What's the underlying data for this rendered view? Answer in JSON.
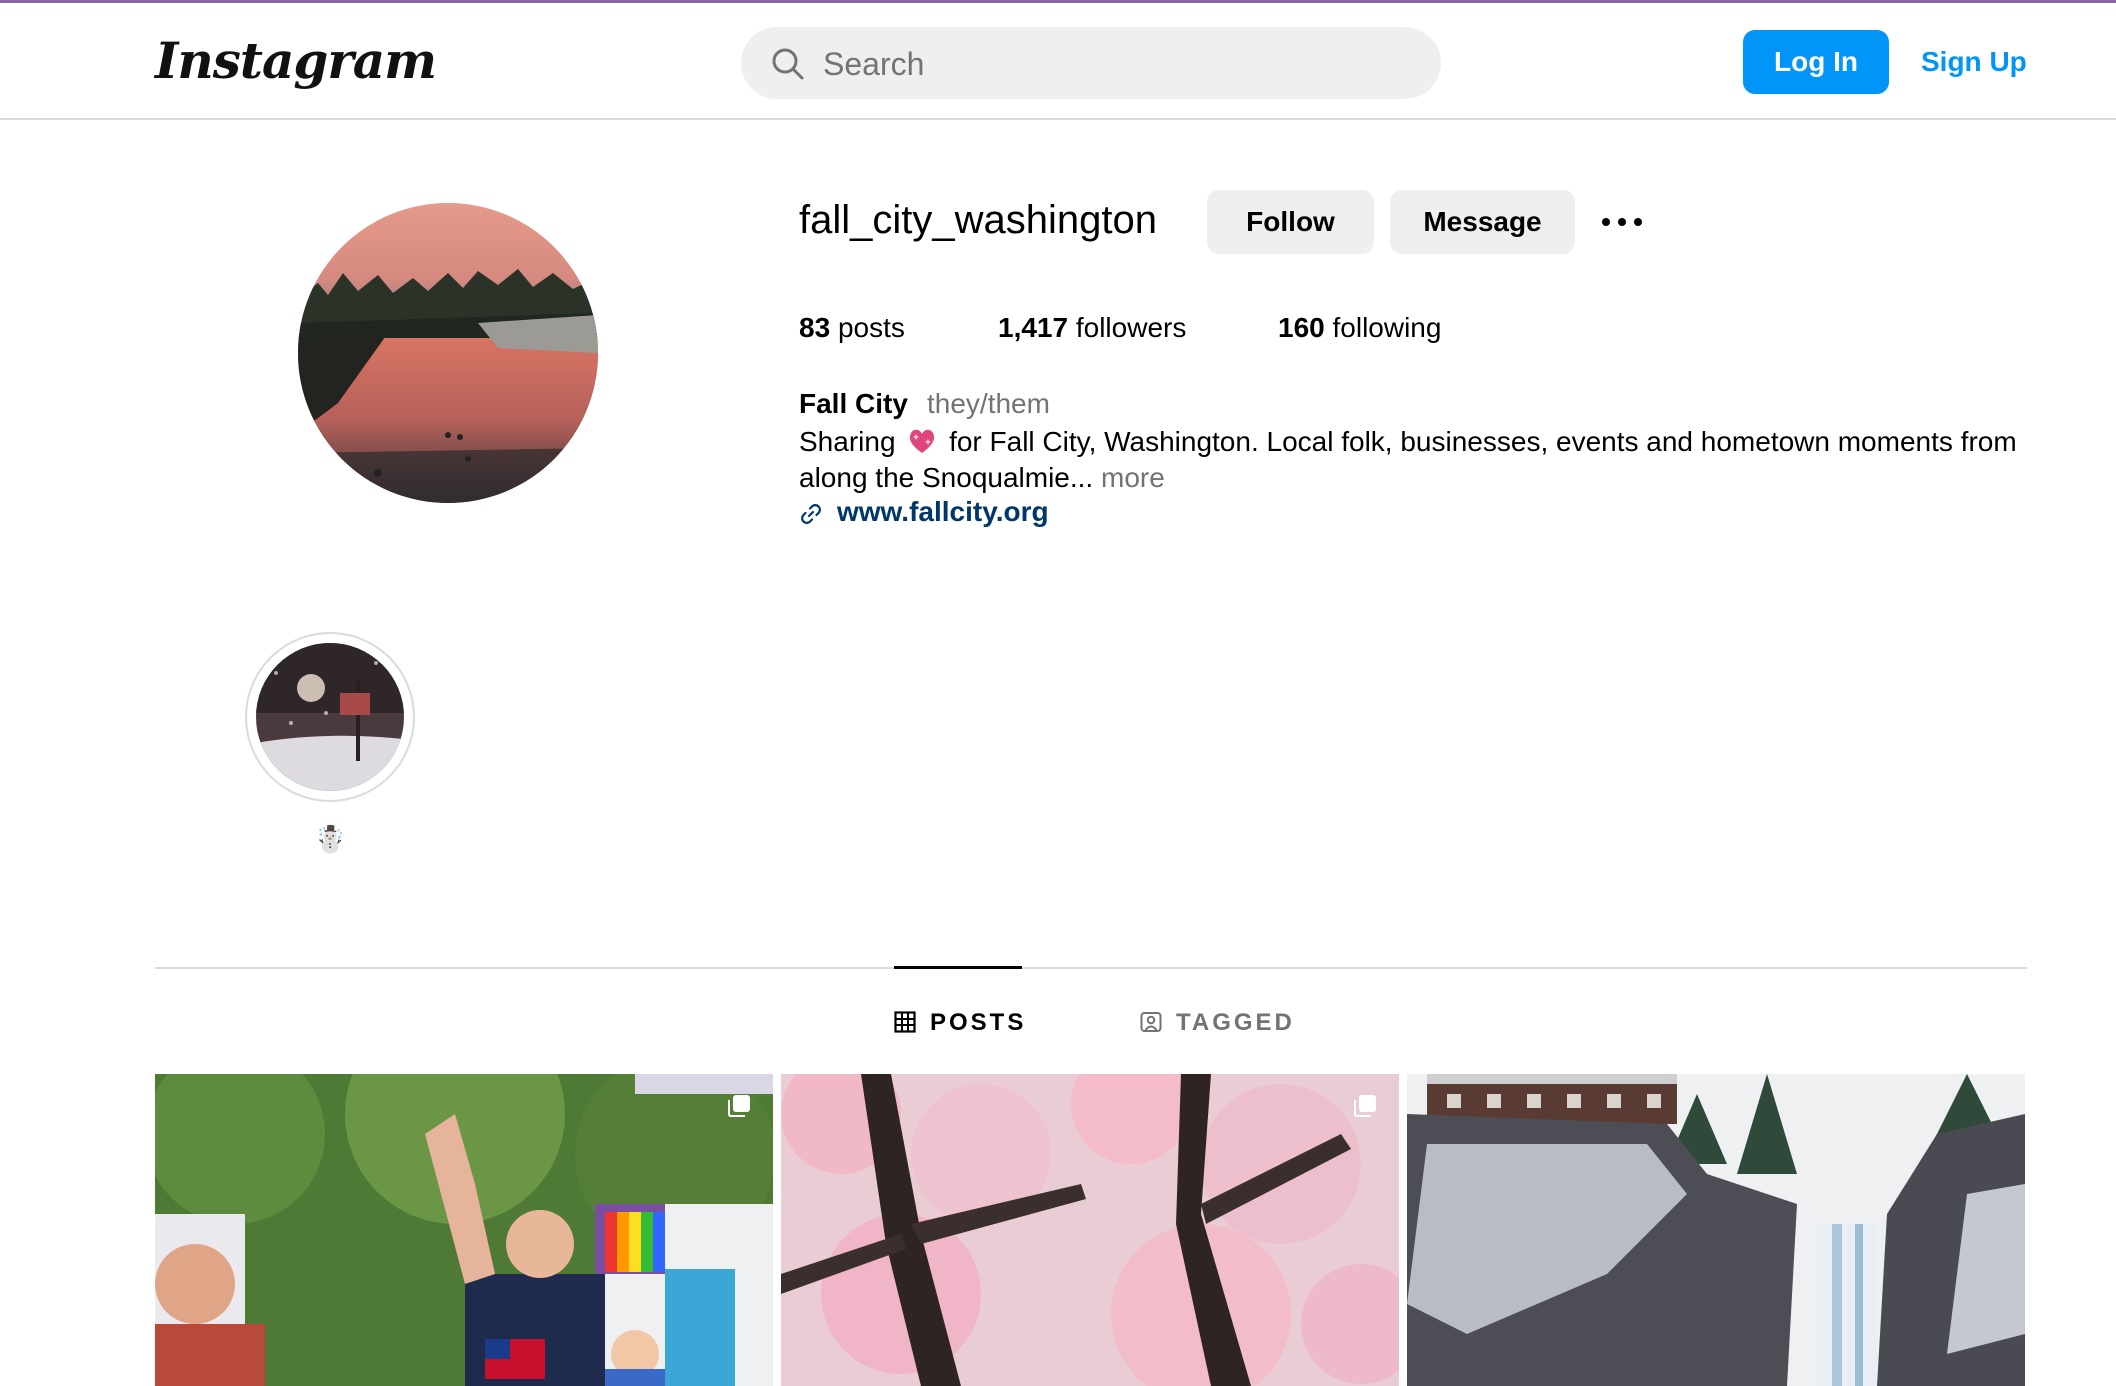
{
  "app": {
    "logo_text": "Instagram"
  },
  "header": {
    "search_placeholder": "Search",
    "login_label": "Log In",
    "signup_label": "Sign Up"
  },
  "profile": {
    "username": "fall_city_washington",
    "follow_label": "Follow",
    "message_label": "Message",
    "stats": {
      "posts_count": "83",
      "posts_label": "posts",
      "followers_count": "1,417",
      "followers_label": "followers",
      "following_count": "160",
      "following_label": "following"
    },
    "full_name": "Fall City",
    "pronouns": "they/them",
    "bio_prefix": "Sharing",
    "bio_emoji": "sparkling-heart",
    "bio_rest": "for Fall City, Washington. Local folk, businesses, events and hometown moments from along the Snoqualmie...",
    "bio_more": "more",
    "website": "www.fallcity.org"
  },
  "highlights": [
    {
      "label": "☃️"
    }
  ],
  "tabs": [
    {
      "label": "POSTS",
      "active": true,
      "icon": "grid-icon"
    },
    {
      "label": "TAGGED",
      "active": false,
      "icon": "tagged-icon"
    }
  ],
  "posts": [
    {
      "subject": "parade",
      "multi": true
    },
    {
      "subject": "cherry-blossoms",
      "multi": true
    },
    {
      "subject": "snoqualmie-falls",
      "multi": false
    }
  ],
  "colors": {
    "accent_blue": "#0095f6",
    "link_blue": "#00376b",
    "secondary_text": "#737373",
    "button_gray": "#efefef"
  }
}
